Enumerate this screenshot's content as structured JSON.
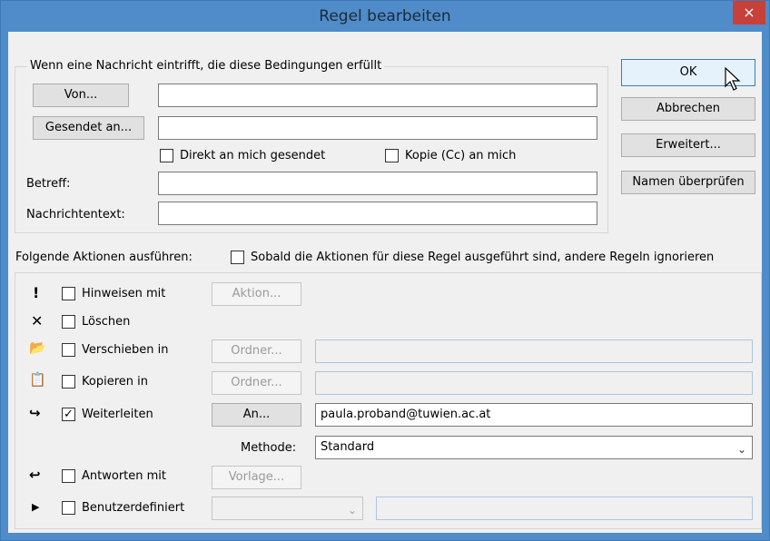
{
  "window": {
    "title": "Regel bearbeiten",
    "close_glyph": "×"
  },
  "conditions": {
    "group_label": "Wenn eine Nachricht eintrifft, die diese Bedingungen erfüllt",
    "from_button": "Von...",
    "from_value": "",
    "sent_to_button": "Gesendet an...",
    "sent_to_value": "",
    "direct_to_me": {
      "label": "Direkt an mich gesendet",
      "checked": false
    },
    "cc_to_me": {
      "label": "Kopie (Cc) an mich",
      "checked": false
    },
    "subject_label": "Betreff:",
    "subject_value": "",
    "body_label": "Nachrichtentext:",
    "body_value": ""
  },
  "side_buttons": {
    "ok": "OK",
    "cancel": "Abbrechen",
    "advanced": "Erweitert...",
    "check_names": "Namen überprüfen"
  },
  "actions": {
    "header_label": "Folgende Aktionen ausführen:",
    "stop_rules": {
      "label": "Sobald die Aktionen für diese Regel ausgeführt sind, andere Regeln ignorieren",
      "checked": false
    },
    "alert": {
      "label": "Hinweisen mit",
      "checked": false,
      "button": "Aktion...",
      "icon": "exclamation-icon",
      "glyph": "!"
    },
    "delete": {
      "label": "Löschen",
      "checked": false,
      "icon": "delete-x-icon",
      "glyph": "✕"
    },
    "move": {
      "label": "Verschieben in",
      "checked": false,
      "button": "Ordner...",
      "value": "",
      "icon": "move-folder-icon",
      "glyph": "📂"
    },
    "copy": {
      "label": "Kopieren in",
      "checked": false,
      "button": "Ordner...",
      "value": "",
      "icon": "copy-folder-icon",
      "glyph": "📋"
    },
    "forward": {
      "label": "Weiterleiten",
      "checked": true,
      "button": "An...",
      "value": "paula.proband@tuwien.ac.at",
      "icon": "forward-icon",
      "glyph": "↪"
    },
    "method": {
      "label": "Methode:",
      "value": "Standard"
    },
    "reply": {
      "label": "Antworten mit",
      "checked": false,
      "button": "Vorlage...",
      "icon": "reply-icon",
      "glyph": "↩"
    },
    "custom": {
      "label": "Benutzerdefiniert",
      "checked": false,
      "value": "",
      "icon": "expand-arrow-icon",
      "glyph": "▶"
    },
    "check_glyph": "✓",
    "dropdown_glyph": "⌄"
  }
}
